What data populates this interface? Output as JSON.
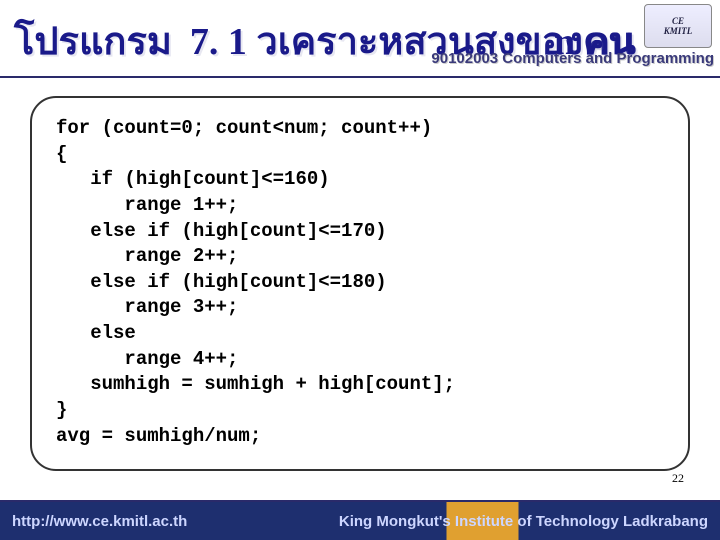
{
  "header": {
    "title_left": "โปรแกรม",
    "title_num": "7. 1 วเคราะหสวนสงของคน",
    "title_right": "n คน",
    "course_line": "90102003 Computers and Programming",
    "logo_top": "CE",
    "logo_bottom": "KMITL"
  },
  "code": {
    "lines": [
      "for (count=0; count<num; count++)",
      "{",
      "   if (high[count]<=160)",
      "      range 1++;",
      "   else if (high[count]<=170)",
      "      range 2++;",
      "   else if (high[count]<=180)",
      "      range 3++;",
      "   else",
      "      range 4++;",
      "   sumhigh = sumhigh + high[count];",
      "}",
      "avg = sumhigh/num;"
    ]
  },
  "slide_number": "22",
  "footer": {
    "url": "http://www.ce.kmitl.ac.th",
    "institution": "King Mongkut's Institute of Technology Ladkrabang"
  }
}
